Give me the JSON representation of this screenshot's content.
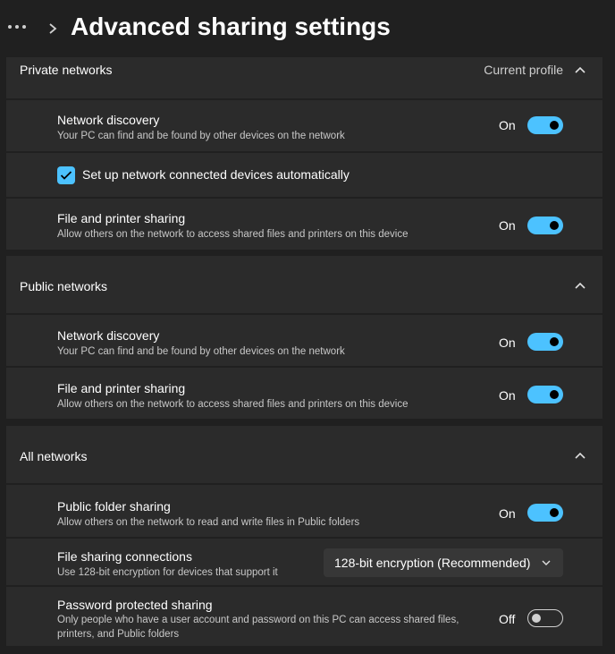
{
  "header": {
    "title": "Advanced sharing settings"
  },
  "colors": {
    "accent": "#4cc2ff",
    "background": "#202020",
    "card": "#2b2b2b"
  },
  "private": {
    "title": "Private networks",
    "subtitle": "Current profile",
    "discovery": {
      "title": "Network discovery",
      "desc": "Your PC can find and be found by other devices on the network",
      "state": "On"
    },
    "auto_setup": {
      "label": "Set up network connected devices automatically",
      "checked": true
    },
    "file_printer": {
      "title": "File and printer sharing",
      "desc": "Allow others on the network to access shared files and printers on this device",
      "state": "On"
    }
  },
  "public": {
    "title": "Public networks",
    "discovery": {
      "title": "Network discovery",
      "desc": "Your PC can find and be found by other devices on the network",
      "state": "On"
    },
    "file_printer": {
      "title": "File and printer sharing",
      "desc": "Allow others on the network to access shared files and printers on this device",
      "state": "On"
    }
  },
  "all": {
    "title": "All networks",
    "public_folder": {
      "title": "Public folder sharing",
      "desc": "Allow others on the network to read and write files in Public folders",
      "state": "On"
    },
    "connections": {
      "title": "File sharing connections",
      "desc": "Use 128-bit encryption for devices that support it",
      "selected": "128-bit encryption (Recommended)"
    },
    "password": {
      "title": "Password protected sharing",
      "desc": "Only people who have a user account and password on this PC can access shared files, printers, and Public folders",
      "state": "Off"
    }
  }
}
